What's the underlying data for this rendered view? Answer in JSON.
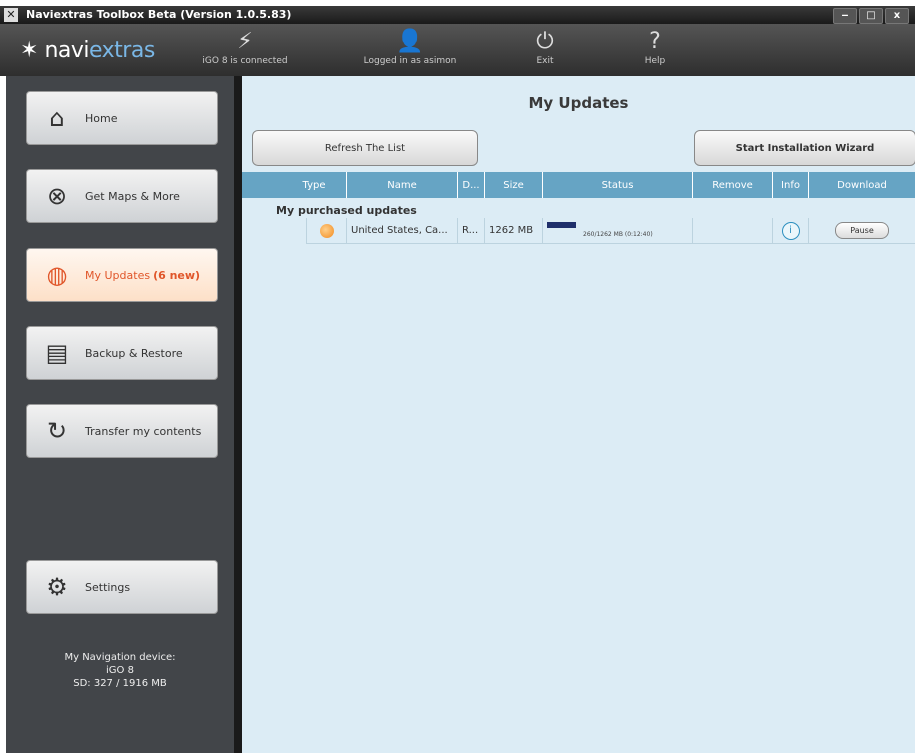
{
  "window": {
    "title": "Naviextras Toolbox Beta (Version 1.0.5.83)",
    "buttons": [
      "‒",
      "□",
      "x"
    ]
  },
  "toolbar": {
    "logo": {
      "prefix": "navi",
      "accent": "extras"
    },
    "items": [
      {
        "label": "iGO 8 is connected",
        "icon": "plug-icon"
      },
      {
        "label": "Logged in as asimon",
        "icon": "user-icon"
      },
      {
        "label": "Exit",
        "icon": "exit-icon"
      },
      {
        "label": "Help",
        "icon": "help-icon"
      }
    ]
  },
  "sidebar": {
    "items": [
      {
        "label": "Home",
        "icon": "home-icon"
      },
      {
        "label": "Get Maps & More",
        "icon": "compass-icon"
      },
      {
        "label": "My Updates",
        "badge": "(6 new)",
        "icon": "globe-icon",
        "active": true
      },
      {
        "label": "Backup & Restore",
        "icon": "backup-icon"
      },
      {
        "label": "Transfer my contents",
        "icon": "transfer-icon"
      },
      {
        "label": "Settings",
        "icon": "gear-icon"
      }
    ],
    "device": {
      "line1": "My Navigation device:",
      "line2": "iGO 8",
      "line3": "SD: 327 / 1916 MB"
    }
  },
  "main": {
    "title": "My Updates",
    "refresh_label": "Refresh The List",
    "wizard_label": "Start Installation Wizard",
    "columns": [
      "Type",
      "Name",
      "D...",
      "Size",
      "Status",
      "Remove",
      "Info",
      "Download"
    ],
    "group_label": "My purchased updates",
    "rows": [
      {
        "name": "United States, Ca...",
        "d": "R...",
        "size": "1262 MB",
        "status": "260/1262 MB (0:12:40)",
        "progress": 0.206,
        "info": "i",
        "download": "Pause"
      }
    ]
  },
  "colors": {
    "accent": "#e0562a",
    "header": "#66a4c4",
    "panel": "#dcecf5",
    "sidebar": "#424549"
  }
}
